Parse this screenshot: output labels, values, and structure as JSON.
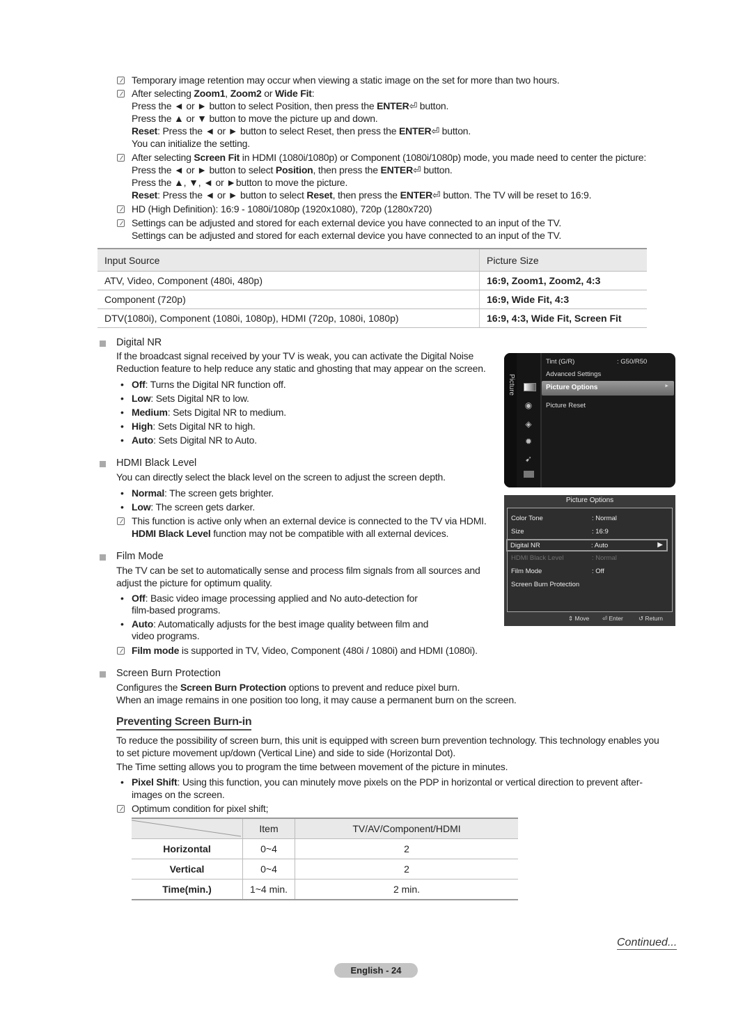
{
  "notes_top": [
    {
      "lines": [
        [
          {
            "t": "Temporary image retention may occur when viewing a static image on the set for more than two hours."
          }
        ]
      ]
    },
    {
      "lines": [
        [
          {
            "t": "After selecting "
          },
          {
            "t": "Zoom1",
            "b": true
          },
          {
            "t": ", "
          },
          {
            "t": "Zoom2",
            "b": true
          },
          {
            "t": " or "
          },
          {
            "t": "Wide Fit",
            "b": true
          },
          {
            "t": ":"
          }
        ],
        [
          {
            "t": "Press the ◄ or ► button to select Position, then press the "
          },
          {
            "t": "ENTER",
            "b": true
          },
          {
            "t": "⏎ button."
          }
        ],
        [
          {
            "t": "Press the ▲ or ▼ button to move the picture up and down."
          }
        ],
        [
          {
            "t": "Reset",
            "b": true
          },
          {
            "t": ": Press the ◄ or ► button to select Reset, then press the "
          },
          {
            "t": "ENTER",
            "b": true
          },
          {
            "t": "⏎ button."
          }
        ],
        [
          {
            "t": "You can initialize the setting."
          }
        ]
      ]
    },
    {
      "lines": [
        [
          {
            "t": "After selecting "
          },
          {
            "t": "Screen Fit",
            "b": true
          },
          {
            "t": " in HDMI (1080i/1080p) or Component (1080i/1080p) mode, you made need to center the picture:"
          }
        ],
        [
          {
            "t": "Press the ◄ or ► button to select "
          },
          {
            "t": "Position",
            "b": true
          },
          {
            "t": ", then press the "
          },
          {
            "t": "ENTER",
            "b": true
          },
          {
            "t": "⏎ button."
          }
        ],
        [
          {
            "t": "Press the ▲, ▼, ◄ or ►button to move the picture."
          }
        ],
        [
          {
            "t": "Reset",
            "b": true
          },
          {
            "t": ": Press the ◄ or ► button to select "
          },
          {
            "t": "Reset",
            "b": true
          },
          {
            "t": ", then press the "
          },
          {
            "t": "ENTER",
            "b": true
          },
          {
            "t": "⏎ button. The TV will be reset to 16:9."
          }
        ]
      ]
    },
    {
      "lines": [
        [
          {
            "t": "HD (High Definition): 16:9 - 1080i/1080p (1920x1080), 720p (1280x720)"
          }
        ]
      ]
    },
    {
      "lines": [
        [
          {
            "t": "Settings can be adjusted and stored for each external device you have connected to an input of the TV."
          }
        ],
        [
          {
            "t": "Settings can be adjusted and stored for each external device you have connected to an input of the TV."
          }
        ]
      ]
    }
  ],
  "source_table": {
    "headers": [
      "Input Source",
      "Picture Size"
    ],
    "rows": [
      [
        "ATV, Video, Component (480i, 480p)",
        "16:9, Zoom1, Zoom2, 4:3"
      ],
      [
        "Component (720p)",
        "16:9, Wide Fit, 4:3"
      ],
      [
        "DTV(1080i), Component (1080i, 1080p), HDMI (720p, 1080i, 1080p)",
        "16:9, 4:3, Wide Fit, Screen Fit"
      ]
    ]
  },
  "digital_nr": {
    "title": "Digital NR",
    "desc": [
      "If the broadcast signal received by your TV is weak, you can activate the Digital Noise",
      "Reduction feature to help reduce any static and ghosting that may appear on the screen."
    ],
    "bullets": [
      {
        "k": "Off",
        "v": ": Turns the Digital NR function off."
      },
      {
        "k": "Low",
        "v": ": Sets Digital NR to low."
      },
      {
        "k": "Medium",
        "v": ": Sets Digital NR to medium."
      },
      {
        "k": "High",
        "v": ": Sets Digital NR to high."
      },
      {
        "k": "Auto",
        "v": ": Sets Digital NR to Auto."
      }
    ]
  },
  "hdmi_black": {
    "title": "HDMI Black Level",
    "desc": "You can directly select the black level on the screen to adjust the screen depth.",
    "bullets": [
      {
        "k": "Normal",
        "v": ": The screen gets brighter."
      },
      {
        "k": "Low",
        "v": ": The screen gets darker."
      }
    ],
    "note1": "This function is active only when an external device is connected to the TV via HDMI.",
    "note2_b": "HDMI Black Level",
    "note2": " function may not be compatible with all external devices."
  },
  "film_mode": {
    "title": "Film Mode",
    "desc": [
      "The TV can be set to automatically sense and process film signals from all sources and",
      "adjust the picture for optimum quality."
    ],
    "bullets": [
      {
        "k": "Off",
        "v": ": Basic video image processing applied and No auto-detection for",
        "cont": "film-based programs."
      },
      {
        "k": "Auto",
        "v": ": Automatically adjusts for the best image quality between film and",
        "cont": "video programs."
      }
    ],
    "note_b": "Film mode",
    "note": " is supported in TV, Video, Component (480i / 1080i) and HDMI (1080i)."
  },
  "screen_burn": {
    "title": "Screen Burn Protection",
    "line1_a": "Configures the ",
    "line1_b": "Screen Burn Protection",
    "line1_c": " options to prevent and reduce pixel burn.",
    "line2": "When an image remains in one position too long, it may cause a permanent burn on the screen."
  },
  "preventing": {
    "title": "Preventing Screen Burn-in",
    "p1": [
      "To reduce the possibility of screen burn, this unit is equipped with screen burn prevention technology. This technology enables you",
      "to set picture movement up/down (Vertical Line) and side to side (Horizontal Dot)."
    ],
    "p2": "The Time setting allows you to program the time between movement of the picture in minutes.",
    "bullet_k": "Pixel Shift",
    "bullet_v": ": Using this function, you can minutely move pixels on the PDP in horizontal or vertical direction to prevent after-",
    "bullet_cont": "images on the screen.",
    "note": "Optimum condition for pixel shift;"
  },
  "pixel_table": {
    "headers": [
      "",
      "Item",
      "TV/AV/Component/HDMI"
    ],
    "rows": [
      [
        "Horizontal",
        "0~4",
        "2"
      ],
      [
        "Vertical",
        "0~4",
        "2"
      ],
      [
        "Time(min.)",
        "1~4 min.",
        "2 min."
      ]
    ]
  },
  "tv_menu": {
    "tab": "Picture",
    "icons": [
      "picture-icon",
      "sound-icon",
      "channel-icon",
      "setup-icon",
      "input-icon",
      "application-icon"
    ],
    "items": [
      {
        "k": "Tint (G/R)",
        "v": ": G50/R50"
      },
      {
        "k": "Advanced Settings"
      },
      {
        "k": "Picture Options",
        "selected": true
      },
      {
        "k": "Picture Reset"
      }
    ]
  },
  "picture_options": {
    "title": "Picture Options",
    "rows": [
      {
        "k": "Color Tone",
        "v": ": Normal"
      },
      {
        "k": "Size",
        "v": ": 16:9"
      },
      {
        "k": "Digital NR",
        "v": ": Auto",
        "highlight": true
      },
      {
        "k": "HDMI Black Level",
        "v": ": Normal",
        "disabled": true
      },
      {
        "k": "Film Mode",
        "v": ": Off"
      },
      {
        "k": "Screen Burn Protection",
        "v": ""
      }
    ],
    "footer": {
      "move": "Move",
      "enter": "Enter",
      "return": "Return"
    }
  },
  "continued": "Continued...",
  "page_number": "English - 24"
}
